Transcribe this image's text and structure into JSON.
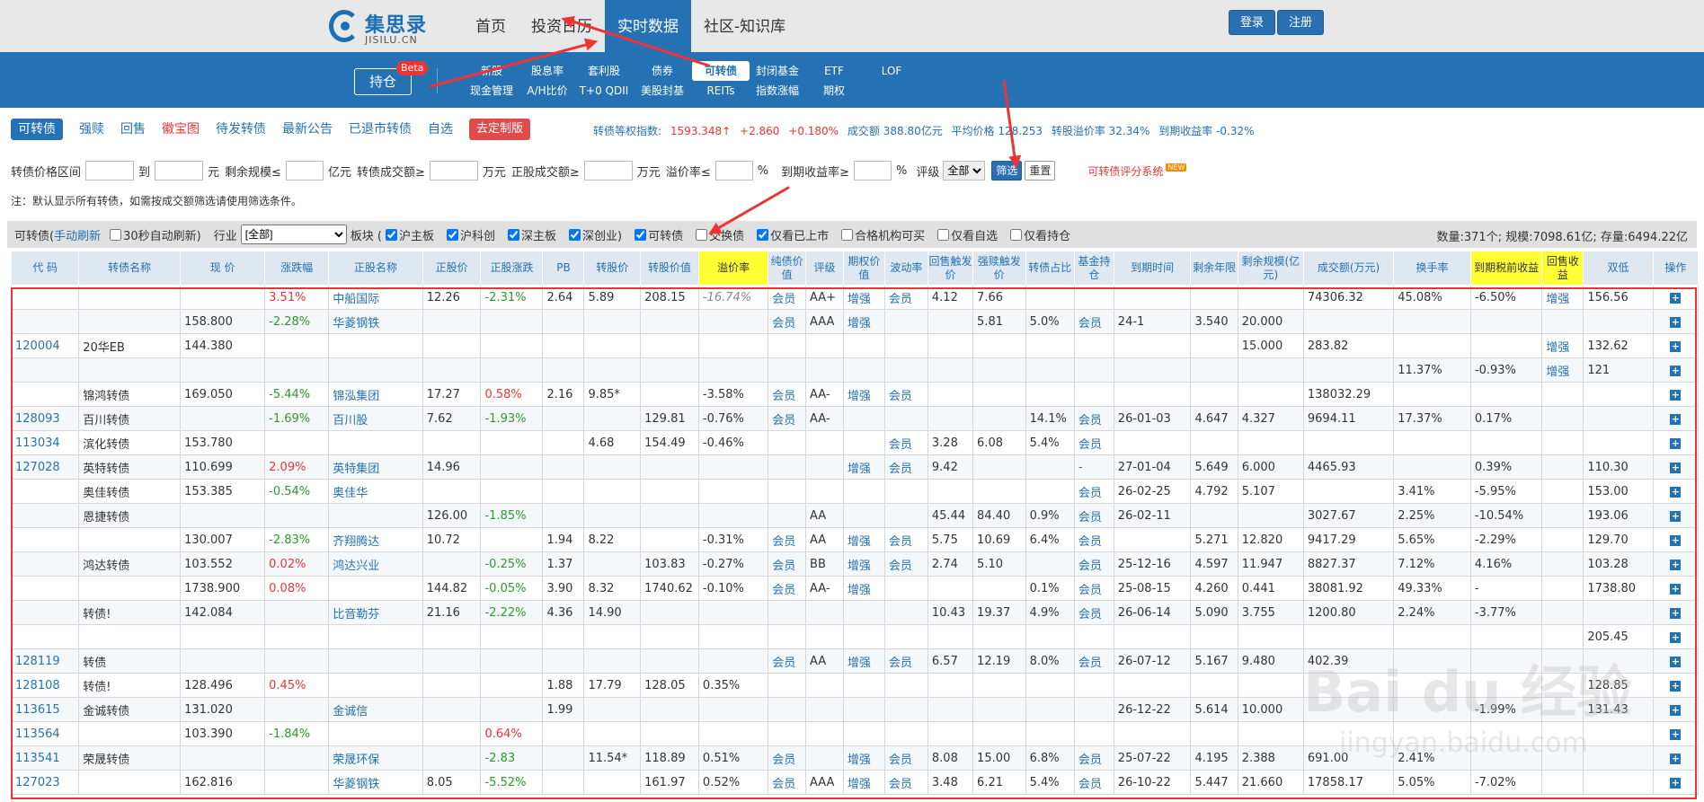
{
  "brand": {
    "name_cn": "集思录",
    "name_en": "JISILU.CN",
    "accent": "#2471b4"
  },
  "nav": {
    "items": [
      "首页",
      "投资日历",
      "实时数据",
      "社区-知识库"
    ],
    "active": "实时数据"
  },
  "auth": {
    "login": "登录",
    "register": "注册"
  },
  "subnav": {
    "hold": "持仓",
    "beta": "Beta",
    "row1": [
      "新股",
      "股息率",
      "套利股",
      "债券",
      "可转债",
      "封闭基金",
      "ETF",
      "LOF"
    ],
    "row2": [
      "现金管理",
      "A/H比价",
      "T+0 QDII",
      "美股封基",
      "REITs",
      "指数涨幅",
      "期权",
      ""
    ],
    "active": "可转债"
  },
  "tabs": [
    "可转债",
    "强赎",
    "回售",
    "徽宝图",
    "待发转债",
    "最新公告",
    "已退市转债",
    "自选",
    "去定制版"
  ],
  "stats": {
    "index_label": "转债等权指数:",
    "index_val": "1593.348↑",
    "chg": "+2.860",
    "pct": "+0.180%",
    "turnover": "成交额 388.80亿元",
    "avg_price": "平均价格 128.253",
    "avg_premium": "转股溢价率 32.34%",
    "ytm": "到期收益率 -0.32%"
  },
  "filter": {
    "price_range": "转债价格区间",
    "to": "到",
    "yuan": "元",
    "remaining": "剩余规模≤",
    "yi": "亿元",
    "bond_turnover": "转债成交额≥",
    "wan1": "万元",
    "stock_turnover": "正股成交额≥",
    "wan2": "万元",
    "premium": "溢价率≤",
    "pct1": "%",
    "ytm": "到期收益率≥",
    "pct2": "%",
    "rating": "评级",
    "rating_sel": "全部",
    "filter_btn": "筛选",
    "reset_btn": "重置",
    "rating_sys": "可转债评分系统",
    "new": "NEW"
  },
  "note": "注：默认显示所有转债，如需按成交额筛选请使用筛选条件。",
  "toolbar": {
    "title": "可转债(",
    "manual": "手动刷新",
    ")": ")",
    "auto": "30秒自动刷新)",
    "industry": "行业",
    "industry_sel": "[全部]",
    "board": "板块 (",
    "boards": [
      "沪主板",
      "沪科创",
      "深主板",
      "深创业)"
    ],
    "types": [
      "可转债",
      "交换债",
      "仅看已上市",
      "合格机构可买",
      "仅看自选",
      "仅看持仓"
    ],
    "summary": "数量:371个; 规模:7098.61亿; 存量:6494.22亿"
  },
  "table": {
    "headers": [
      "代 码",
      "转债名称",
      "现 价",
      "涨跌幅",
      "正股名称",
      "正股价",
      "正股涨跌",
      "PB",
      "转股价",
      "转股价值",
      "溢价率",
      "纯债价值",
      "评级",
      "期权价值",
      "波动率",
      "回售触发价",
      "强赎触发价",
      "转债占比",
      "基金持仓",
      "到期时间",
      "剩余年限",
      "剩余规模(亿元)",
      "成交额(万元)",
      "换手率",
      "到期税前收益",
      "回售收益",
      "双低",
      "操作"
    ],
    "rows": [
      [
        "",
        "",
        "",
        "3.51%",
        "中船国际",
        "12.26",
        "-2.31%",
        "2.64",
        "5.89",
        "208.15",
        "-16.74%",
        "会员",
        "AA+",
        "增强",
        "会员",
        "4.12",
        "7.66",
        "",
        "",
        "",
        "",
        "",
        "74306.32",
        "45.08%",
        "-6.50%",
        "增强",
        "156.56",
        ""
      ],
      [
        "",
        "",
        "158.800",
        "-2.28%",
        "华菱钢铁",
        "",
        "",
        "",
        "",
        "",
        "",
        "会员",
        "AAA",
        "增强",
        "",
        "",
        "5.81",
        "5.0%",
        "会员",
        "24-1",
        "3.540",
        "20.000",
        "",
        "",
        "",
        "",
        "",
        ""
      ],
      [
        "120004",
        "20华EB",
        "144.380",
        "",
        "",
        "",
        "",
        "",
        "",
        "",
        "",
        "",
        "",
        "",
        "",
        "",
        "",
        "",
        "",
        "",
        "",
        "15.000",
        "283.82",
        "",
        "",
        "增强",
        "132.62",
        ""
      ],
      [
        "",
        "",
        "",
        "",
        "",
        "",
        "",
        "",
        "",
        "",
        "",
        "",
        "",
        "",
        "",
        "",
        "",
        "",
        "",
        "",
        "",
        "",
        "",
        "11.37%",
        "-0.93%",
        "增强",
        "121",
        ""
      ],
      [
        "",
        "锦鸿转债",
        "169.050",
        "-5.44%",
        "锦泓集团",
        "17.27",
        "0.58%",
        "2.16",
        "9.85*",
        "",
        "-3.58%",
        "会员",
        "AA-",
        "增强",
        "会员",
        "",
        "",
        "",
        "",
        "",
        "",
        "",
        "138032.29",
        "",
        "",
        "",
        "",
        ""
      ],
      [
        "128093",
        "百川转债",
        "",
        "-1.69%",
        "百川股",
        "7.62",
        "-1.93%",
        "",
        "",
        "129.81",
        "-0.76%",
        "会员",
        "AA-",
        "",
        "",
        "",
        "",
        "14.1%",
        "会员",
        "26-01-03",
        "4.647",
        "4.327",
        "9694.11",
        "17.37%",
        "0.17%",
        "",
        "",
        ""
      ],
      [
        "113034",
        "滨化转债",
        "153.780",
        "",
        "",
        "",
        "",
        "",
        "4.68",
        "154.49",
        "-0.46%",
        "",
        "",
        "",
        "会员",
        "3.28",
        "6.08",
        "5.4%",
        "会员",
        "",
        "",
        "",
        "",
        "",
        "",
        "",
        "",
        ""
      ],
      [
        "127028",
        "英特转债",
        "110.699",
        "2.09%",
        "英特集团",
        "14.96",
        "",
        "",
        "",
        "",
        "",
        "",
        "",
        "增强",
        "会员",
        "9.42",
        "",
        "",
        "-",
        "27-01-04",
        "5.649",
        "6.000",
        "4465.93",
        "",
        "0.39%",
        "",
        "110.30",
        ""
      ],
      [
        "",
        "奥佳转债",
        "153.385",
        "-0.54%",
        "奥佳华",
        "",
        "",
        "",
        "",
        "",
        "",
        "",
        "",
        "",
        "",
        "",
        "",
        "",
        "会员",
        "26-02-25",
        "4.792",
        "5.107",
        "",
        "3.41%",
        "-5.95%",
        "",
        "153.00",
        ""
      ],
      [
        "",
        "恩捷转债",
        "",
        "",
        "",
        "126.00",
        "-1.85%",
        "",
        "",
        "",
        "",
        "",
        "AA",
        "",
        "",
        "45.44",
        "84.40",
        "0.9%",
        "会员",
        "26-02-11",
        "",
        "",
        "3027.67",
        "2.25%",
        "-10.54%",
        "",
        "193.06",
        ""
      ],
      [
        "",
        "",
        "130.007",
        "-2.83%",
        "齐翔腾达",
        "10.72",
        "",
        "1.94",
        "8.22",
        "",
        "-0.31%",
        "会员",
        "AA",
        "增强",
        "会员",
        "5.75",
        "10.69",
        "6.4%",
        "会员",
        "",
        "5.271",
        "12.820",
        "9417.29",
        "5.65%",
        "-2.29%",
        "",
        "129.70",
        ""
      ],
      [
        "",
        "鸿达转债",
        "103.552",
        "0.02%",
        "鸿达兴业",
        "",
        "-0.25%",
        "1.37",
        "",
        "103.83",
        "-0.27%",
        "会员",
        "BB",
        "增强",
        "会员",
        "2.74",
        "5.10",
        "",
        "会员",
        "25-12-16",
        "4.597",
        "11.947",
        "8827.37",
        "7.12%",
        "4.16%",
        "",
        "103.28",
        ""
      ],
      [
        "",
        "",
        "1738.900",
        "0.08%",
        "",
        "144.82",
        "-0.05%",
        "3.90",
        "8.32",
        "1740.62",
        "-0.10%",
        "会员",
        "AA-",
        "增强",
        "",
        "",
        "",
        "0.1%",
        "会员",
        "25-08-15",
        "4.260",
        "0.441",
        "38081.92",
        "49.33%",
        "-",
        "",
        "1738.80",
        ""
      ],
      [
        "",
        "转债!",
        "142.084",
        "",
        "比音勒芬",
        "21.16",
        "-2.22%",
        "4.36",
        "14.90",
        "",
        "",
        "",
        "",
        "",
        "",
        "10.43",
        "19.37",
        "4.9%",
        "会员",
        "26-06-14",
        "5.090",
        "3.755",
        "1200.80",
        "2.24%",
        "-3.77%",
        "",
        "",
        ""
      ],
      [
        "",
        "",
        "",
        "",
        "",
        "",
        "",
        "",
        "",
        "",
        "",
        "",
        "",
        "",
        "",
        "",
        "",
        "",
        "",
        "",
        "",
        "",
        "",
        "",
        "",
        "",
        "205.45",
        ""
      ],
      [
        "128119",
        "转债",
        "",
        "",
        "",
        "",
        "",
        "",
        "",
        "",
        "",
        "会员",
        "AA",
        "增强",
        "会员",
        "6.57",
        "12.19",
        "8.0%",
        "会员",
        "26-07-12",
        "5.167",
        "9.480",
        "402.39",
        "",
        "",
        "",
        "",
        ""
      ],
      [
        "128108",
        "转债!",
        "128.496",
        "0.45%",
        "",
        "",
        "",
        "1.88",
        "17.79",
        "128.05",
        "0.35%",
        "",
        "",
        "",
        "",
        "",
        "",
        "",
        "",
        "",
        "",
        "",
        "",
        "",
        "",
        "",
        "128.85",
        ""
      ],
      [
        "113615",
        "金诚转债",
        "131.020",
        "",
        "金诚信",
        "",
        "",
        "1.99",
        "",
        "",
        "",
        "",
        "",
        "",
        "",
        "",
        "",
        "",
        "",
        "26-12-22",
        "5.614",
        "10.000",
        "",
        "",
        "-1.99%",
        "",
        "131.43",
        ""
      ],
      [
        "113564",
        "",
        "103.390",
        "-1.84%",
        "",
        "",
        "0.64%",
        "",
        "",
        "",
        "",
        "",
        "",
        "",
        "",
        "",
        "",
        "",
        "",
        "",
        "",
        "",
        "",
        "",
        "",
        "",
        "",
        ""
      ],
      [
        "113541",
        "荣晟转债",
        "",
        "",
        "荣晟环保",
        "",
        "-2.83",
        "",
        "11.54*",
        "118.89",
        "0.51%",
        "会员",
        "",
        "增强",
        "会员",
        "8.08",
        "15.00",
        "6.8%",
        "会员",
        "25-07-22",
        "4.195",
        "2.388",
        "691.00",
        "2.41%",
        "",
        "",
        "",
        ""
      ],
      [
        "127023",
        "",
        "162.816",
        "",
        "华菱钢铁",
        "8.05",
        "-5.52%",
        "",
        "",
        "161.97",
        "0.52%",
        "会员",
        "AAA",
        "增强",
        "会员",
        "3.48",
        "6.21",
        "5.4%",
        "会员",
        "26-10-22",
        "5.447",
        "21.660",
        "17858.17",
        "5.05%",
        "-7.02%",
        "",
        "",
        ""
      ]
    ],
    "plus": "+"
  },
  "watermark": {
    "w1": "Bai du 经验",
    "w2": "jingyan.baidu.com"
  }
}
